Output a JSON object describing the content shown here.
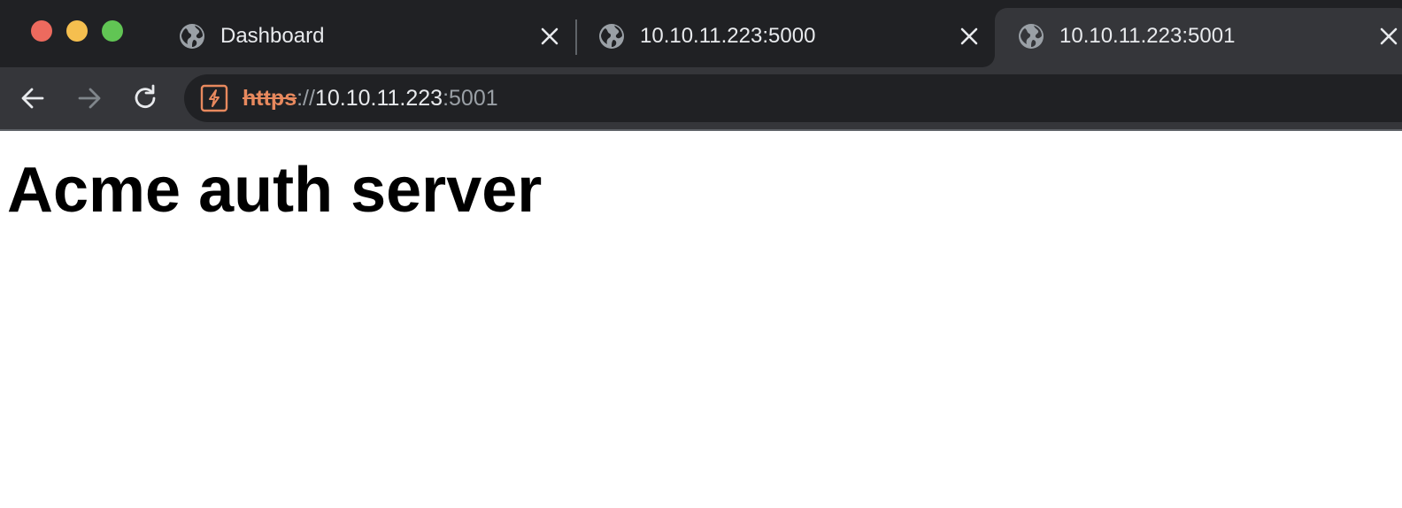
{
  "window": {
    "traffic_lights": [
      "close",
      "minimize",
      "zoom"
    ]
  },
  "tabs": [
    {
      "title": "Dashboard",
      "icon": "globe-icon",
      "active": false
    },
    {
      "title": "10.10.11.223:5000",
      "icon": "globe-icon",
      "active": false
    },
    {
      "title": "10.10.11.223:5001",
      "icon": "globe-icon",
      "active": true
    }
  ],
  "toolbar": {
    "back_icon": "back-arrow-icon",
    "forward_icon": "forward-arrow-icon",
    "reload_icon": "reload-icon",
    "security_icon": "not-secure-icon",
    "url": {
      "scheme": "https",
      "separator": "://",
      "host": "10.10.11.223",
      "port": ":5001"
    }
  },
  "page": {
    "heading": "Acme auth server"
  },
  "colors": {
    "tabstrip_bg": "#202124",
    "toolbar_bg": "#35363a",
    "omnibox_bg": "#202124",
    "insecure_scheme": "#e8895e",
    "traffic_red": "#ed6a5e",
    "traffic_yellow": "#f5bf4f",
    "traffic_green": "#61c554"
  }
}
